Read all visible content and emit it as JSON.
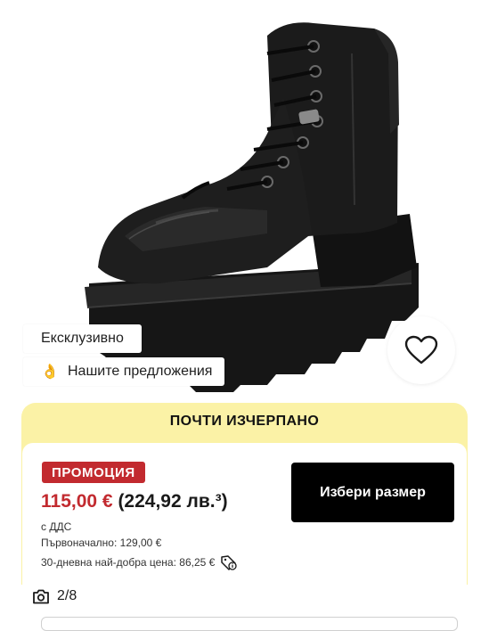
{
  "product": {
    "badges": {
      "exclusive": "Ексклузивно",
      "offers_icon": "👌",
      "offers": "Нашите предложения"
    },
    "wishlist_icon": "heart-outline-icon"
  },
  "stock_banner": {
    "text": "ПОЧТИ ИЗЧЕРПАНО",
    "color": "#fbf2a6"
  },
  "pricing": {
    "promo_label": "ПРОМОЦИЯ",
    "price_now": "115,00 €",
    "price_bgn": "(224,92 лв.³)",
    "vat_note": "с ДДС",
    "original_price": "Първоначално: 129,00 €",
    "best_price_30d": "30-дневна най-добра цена: 86,25 €",
    "promo_color": "#c22a2f"
  },
  "actions": {
    "select_size": "Избери размер"
  },
  "gallery": {
    "counter": "2/8",
    "icon": "camera-icon"
  }
}
